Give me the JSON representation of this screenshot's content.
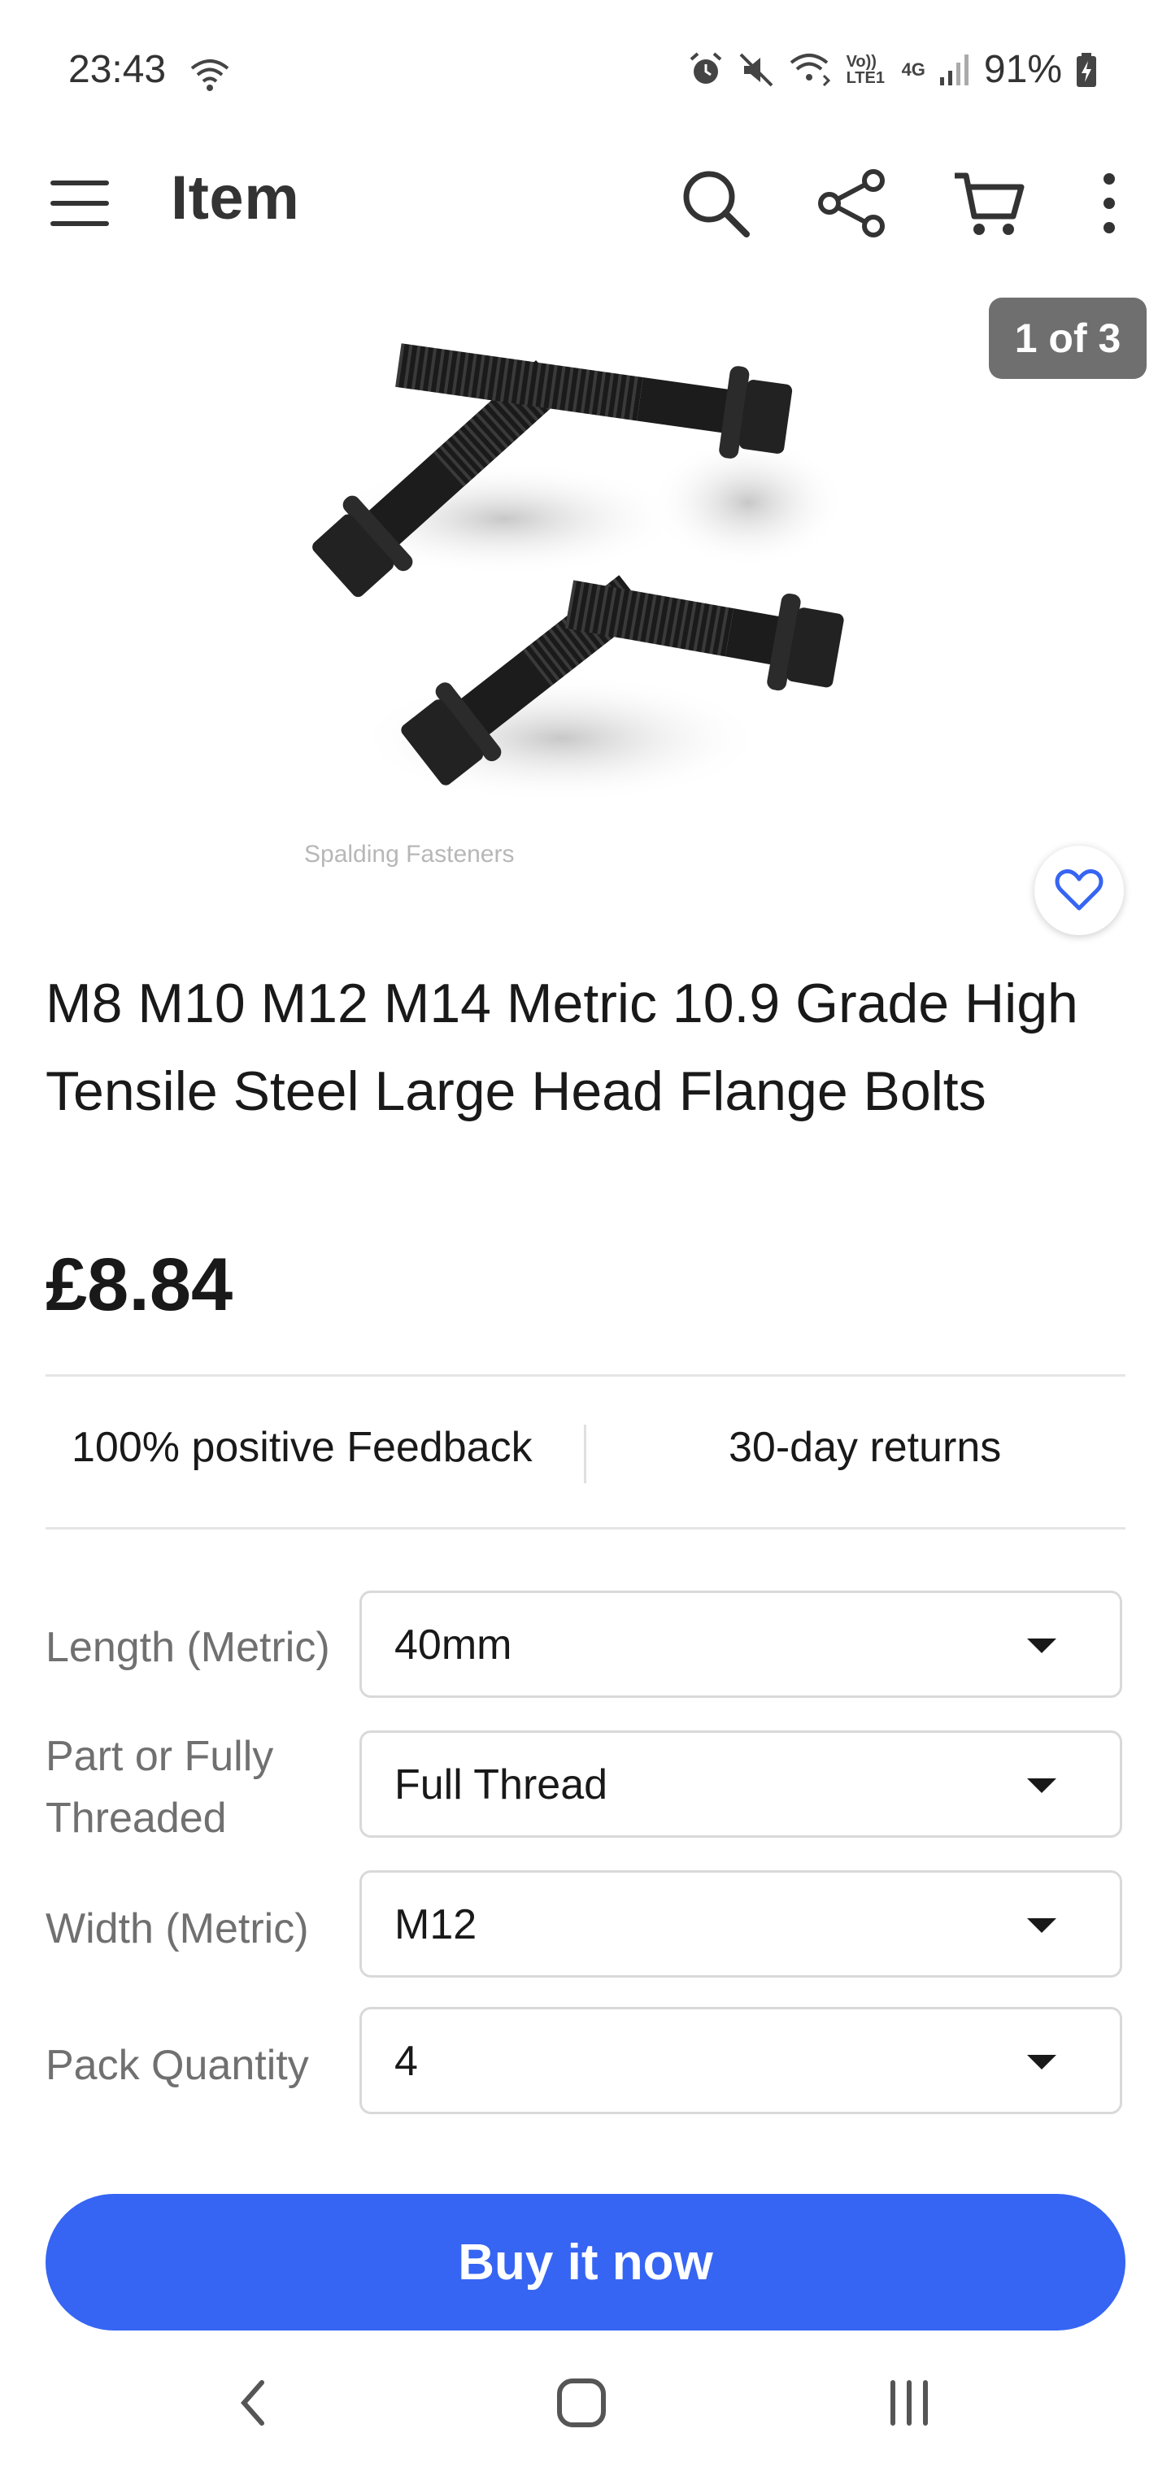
{
  "status_bar": {
    "time": "23:43",
    "battery": "91%",
    "icons": [
      "wifi-icon",
      "alarm-icon",
      "mute-icon",
      "volte-icon",
      "4g-icon",
      "signal-icon",
      "battery-charging-icon"
    ],
    "volte_label": "Vo)) LTE1",
    "network_label": "4G"
  },
  "header": {
    "title": "Item",
    "icons": [
      "menu-icon",
      "search-icon",
      "share-icon",
      "cart-icon",
      "more-vertical-icon"
    ]
  },
  "gallery": {
    "counter": "1 of 3",
    "watermark": "Spalding Fasteners",
    "favorite_icon": "heart-icon"
  },
  "item": {
    "title": "M8 M10 M12 M14 Metric 10.9 Grade High Tensile Steel Large Head Flange Bolts",
    "price": "£8.84"
  },
  "features": {
    "feedback": "100% positive Feedback",
    "returns": "30-day returns"
  },
  "selectors": [
    {
      "label": "Length (Metric)",
      "value": "40mm"
    },
    {
      "label": "Part or Fully Threaded",
      "value": "Full Thread"
    },
    {
      "label": "Width (Metric)",
      "value": "M12"
    },
    {
      "label": "Pack Quantity",
      "value": "4"
    }
  ],
  "actions": {
    "buy_now": "Buy it now"
  },
  "nav_bar": {
    "icons": [
      "back-icon",
      "home-icon",
      "recents-icon"
    ]
  },
  "colors": {
    "accent": "#3665f3",
    "counter_bg": "#6f6f6f",
    "text": "#191919",
    "label": "#707070"
  }
}
